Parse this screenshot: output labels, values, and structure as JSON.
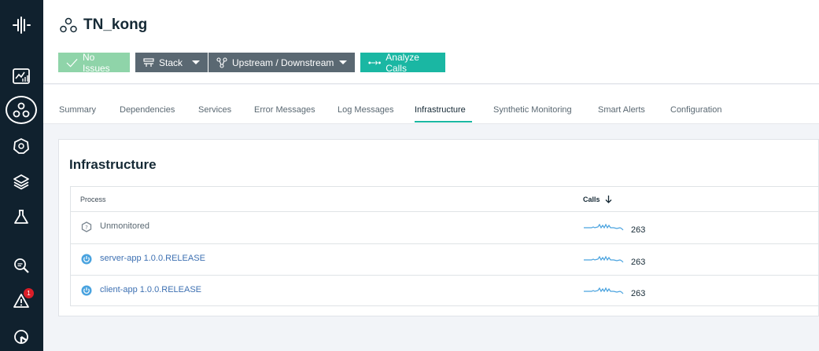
{
  "header": {
    "title": "TN_kong",
    "buttons": {
      "no_issues": "No Issues",
      "stack": "Stack",
      "upstream": "Upstream / Downstream",
      "analyze": "Analyze Calls"
    }
  },
  "tabs": [
    {
      "label": "Summary"
    },
    {
      "label": "Dependencies"
    },
    {
      "label": "Services"
    },
    {
      "label": "Error Messages"
    },
    {
      "label": "Log Messages"
    },
    {
      "label": "Infrastructure"
    },
    {
      "label": "Synthetic Monitoring"
    },
    {
      "label": "Smart Alerts"
    },
    {
      "label": "Configuration"
    }
  ],
  "active_tab": "Infrastructure",
  "card": {
    "title": "Infrastructure",
    "columns": {
      "process": "Process",
      "calls": "Calls"
    },
    "rows": [
      {
        "name": "Unmonitored",
        "calls": "263",
        "icon": "unknown-hexagon-icon"
      },
      {
        "name": "server-app 1.0.0.RELEASE",
        "calls": "263",
        "icon": "spring-power-icon"
      },
      {
        "name": "client-app 1.0.0.RELEASE",
        "calls": "263",
        "icon": "spring-power-icon"
      }
    ]
  },
  "sidebar": {
    "alerts_badge": "1",
    "icons": [
      "logo-icon",
      "dashboard-icon",
      "applications-icon",
      "kubernetes-icon",
      "stack-layers-icon",
      "flask-icon",
      "search-analytics-icon",
      "alert-icon",
      "settings-icon"
    ]
  },
  "colors": {
    "rail": "#10212e",
    "accent": "#1ab7a3",
    "success": "#8fd4a9",
    "neutral_button": "#5a6872",
    "link": "#3d70b2",
    "badge": "#da1e28"
  }
}
